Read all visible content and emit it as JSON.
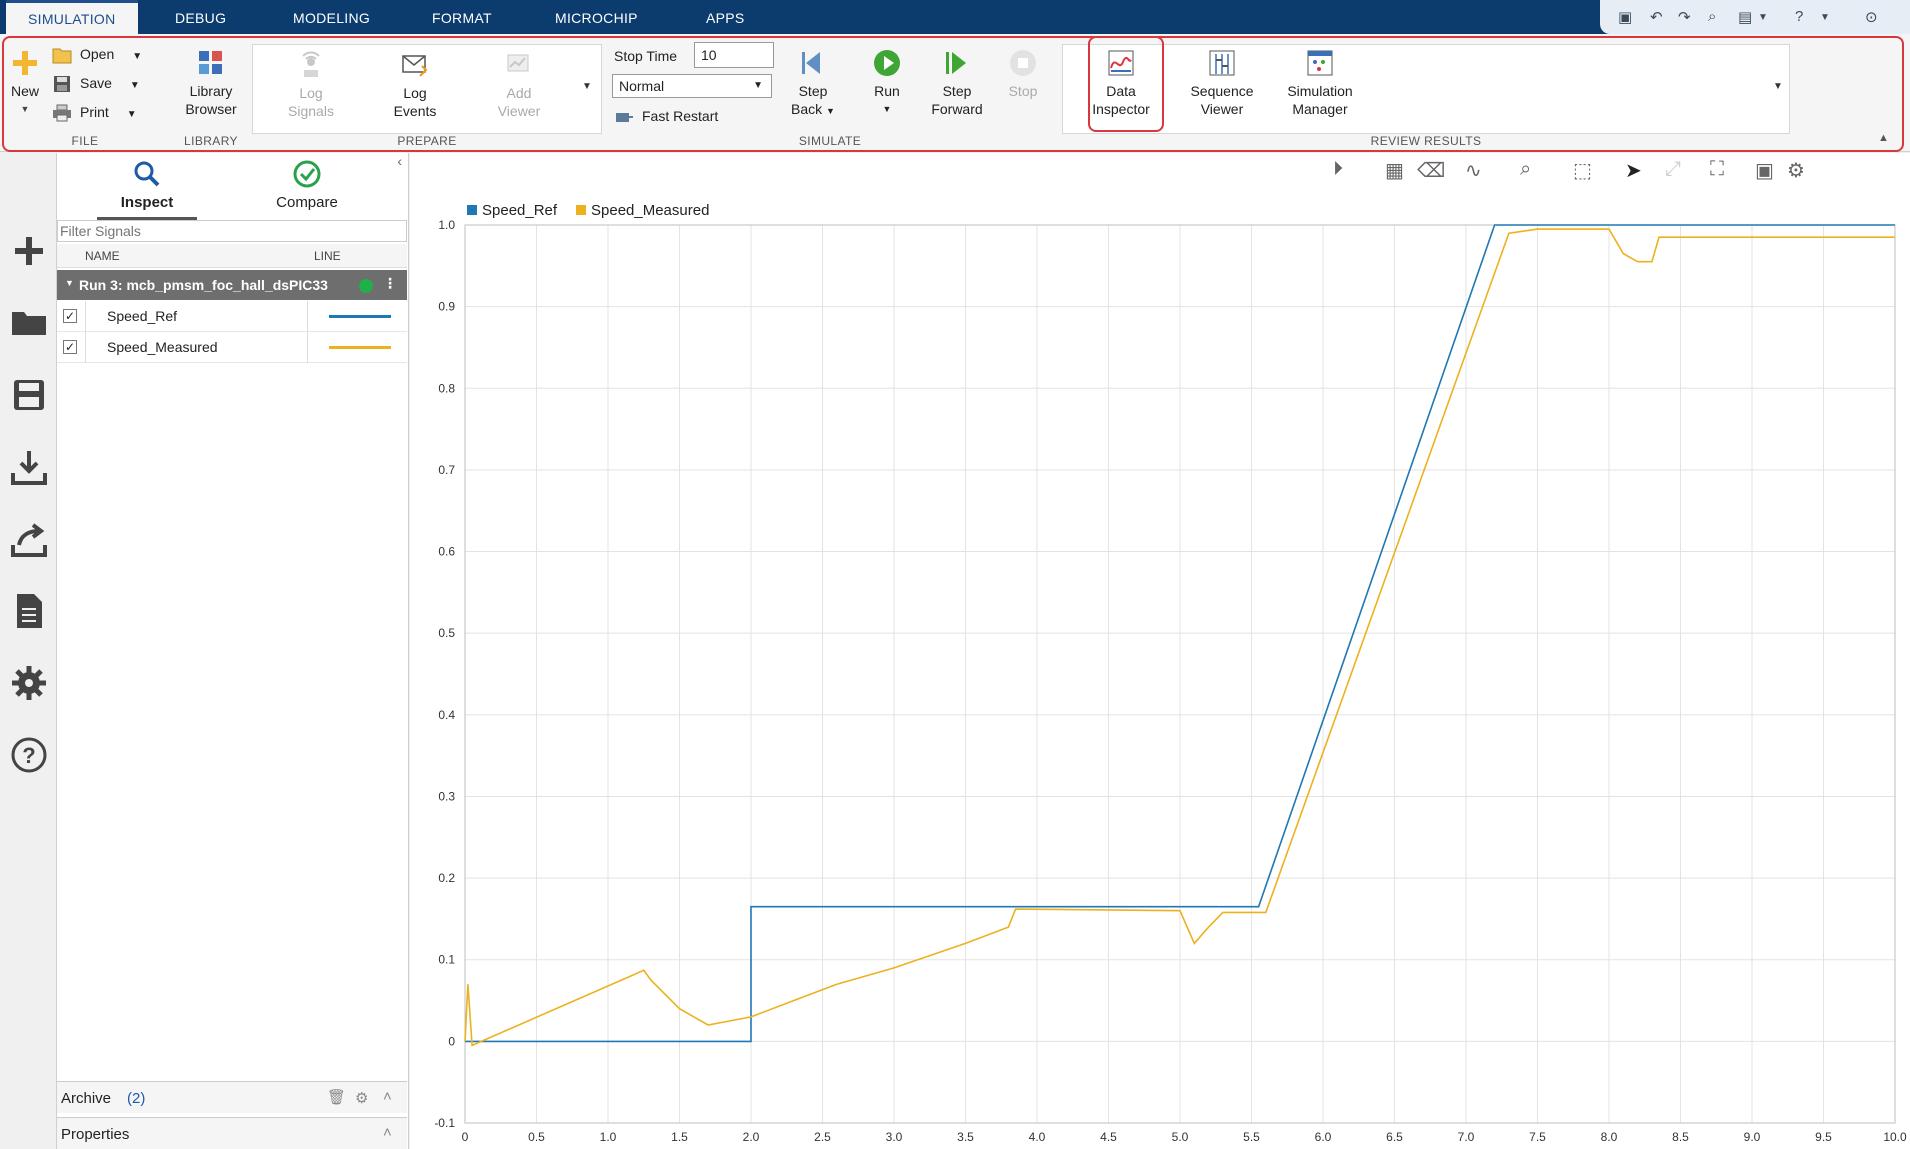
{
  "tabs": [
    "SIMULATION",
    "DEBUG",
    "MODELING",
    "FORMAT",
    "MICROCHIP",
    "APPS"
  ],
  "ribbon": {
    "file": {
      "new": "New",
      "open": "Open",
      "save": "Save",
      "print": "Print",
      "label": "FILE"
    },
    "library": {
      "browser_line1": "Library",
      "browser_line2": "Browser",
      "label": "LIBRARY"
    },
    "prepare": {
      "log_signals_1": "Log",
      "log_signals_2": "Signals",
      "log_events_1": "Log",
      "log_events_2": "Events",
      "add_viewer_1": "Add",
      "add_viewer_2": "Viewer",
      "label": "PREPARE"
    },
    "simulate": {
      "stop_time_label": "Stop Time",
      "stop_time_value": "10",
      "mode": "Normal",
      "fast_restart": "Fast Restart",
      "step_back_1": "Step",
      "step_back_2": "Back",
      "run": "Run",
      "step_forward_1": "Step",
      "step_forward_2": "Forward",
      "stop": "Stop",
      "label": "SIMULATE"
    },
    "review": {
      "data_inspector_1": "Data",
      "data_inspector_2": "Inspector",
      "sequence_viewer_1": "Sequence",
      "sequence_viewer_2": "Viewer",
      "simulation_manager_1": "Simulation",
      "simulation_manager_2": "Manager",
      "label": "REVIEW RESULTS"
    }
  },
  "browser": {
    "inspect_label": "Inspect",
    "compare_label": "Compare",
    "filter_placeholder": "Filter Signals",
    "col_name": "NAME",
    "col_line": "LINE",
    "run_title": "Run 3: mcb_pmsm_foc_hall_dsPIC33",
    "signals": [
      {
        "name": "Speed_Ref",
        "checked": true,
        "color": "#1f77b4"
      },
      {
        "name": "Speed_Measured",
        "checked": true,
        "color": "#edb120"
      }
    ],
    "archive_label": "Archive",
    "archive_count": "(2)",
    "properties_label": "Properties"
  },
  "colors": {
    "accent": "#0b3c6d",
    "highlight": "#d9363e",
    "ref": "#1f77b4",
    "meas": "#edb120"
  },
  "chart_data": {
    "type": "line",
    "title": "",
    "xlabel": "",
    "ylabel": "",
    "xlim": [
      0,
      10
    ],
    "ylim": [
      -0.1,
      1.0
    ],
    "x_ticks": [
      "0",
      "0.5",
      "1.0",
      "1.5",
      "2.0",
      "2.5",
      "3.0",
      "3.5",
      "4.0",
      "4.5",
      "5.0",
      "5.5",
      "6.0",
      "6.5",
      "7.0",
      "7.5",
      "8.0",
      "8.5",
      "9.0",
      "9.5",
      "10.0"
    ],
    "y_ticks": [
      "1.0",
      "0.9",
      "0.8",
      "0.7",
      "0.6",
      "0.5",
      "0.4",
      "0.3",
      "0.2",
      "0.1",
      "0",
      "-0.1"
    ],
    "legend_position": "top-left",
    "grid": true,
    "series": [
      {
        "name": "Speed_Ref",
        "x": [
          0,
          2.0,
          2.0,
          5.55,
          7.2,
          10.0
        ],
        "y": [
          0,
          0,
          0.165,
          0.165,
          1.0,
          1.0
        ]
      },
      {
        "name": "Speed_Measured",
        "x": [
          0,
          0.02,
          0.05,
          1.25,
          1.3,
          1.5,
          1.7,
          2.0,
          2.3,
          2.6,
          3.0,
          3.5,
          3.8,
          3.85,
          5.0,
          5.1,
          5.2,
          5.3,
          5.6,
          7.3,
          7.5,
          8.0,
          8.1,
          8.2,
          8.3,
          8.35,
          10.0
        ],
        "y": [
          0,
          0.07,
          -0.005,
          0.087,
          0.075,
          0.04,
          0.02,
          0.03,
          0.05,
          0.07,
          0.09,
          0.12,
          0.14,
          0.162,
          0.16,
          0.12,
          0.14,
          0.158,
          0.158,
          0.99,
          0.995,
          0.995,
          0.965,
          0.955,
          0.955,
          0.985,
          0.985
        ]
      }
    ]
  }
}
